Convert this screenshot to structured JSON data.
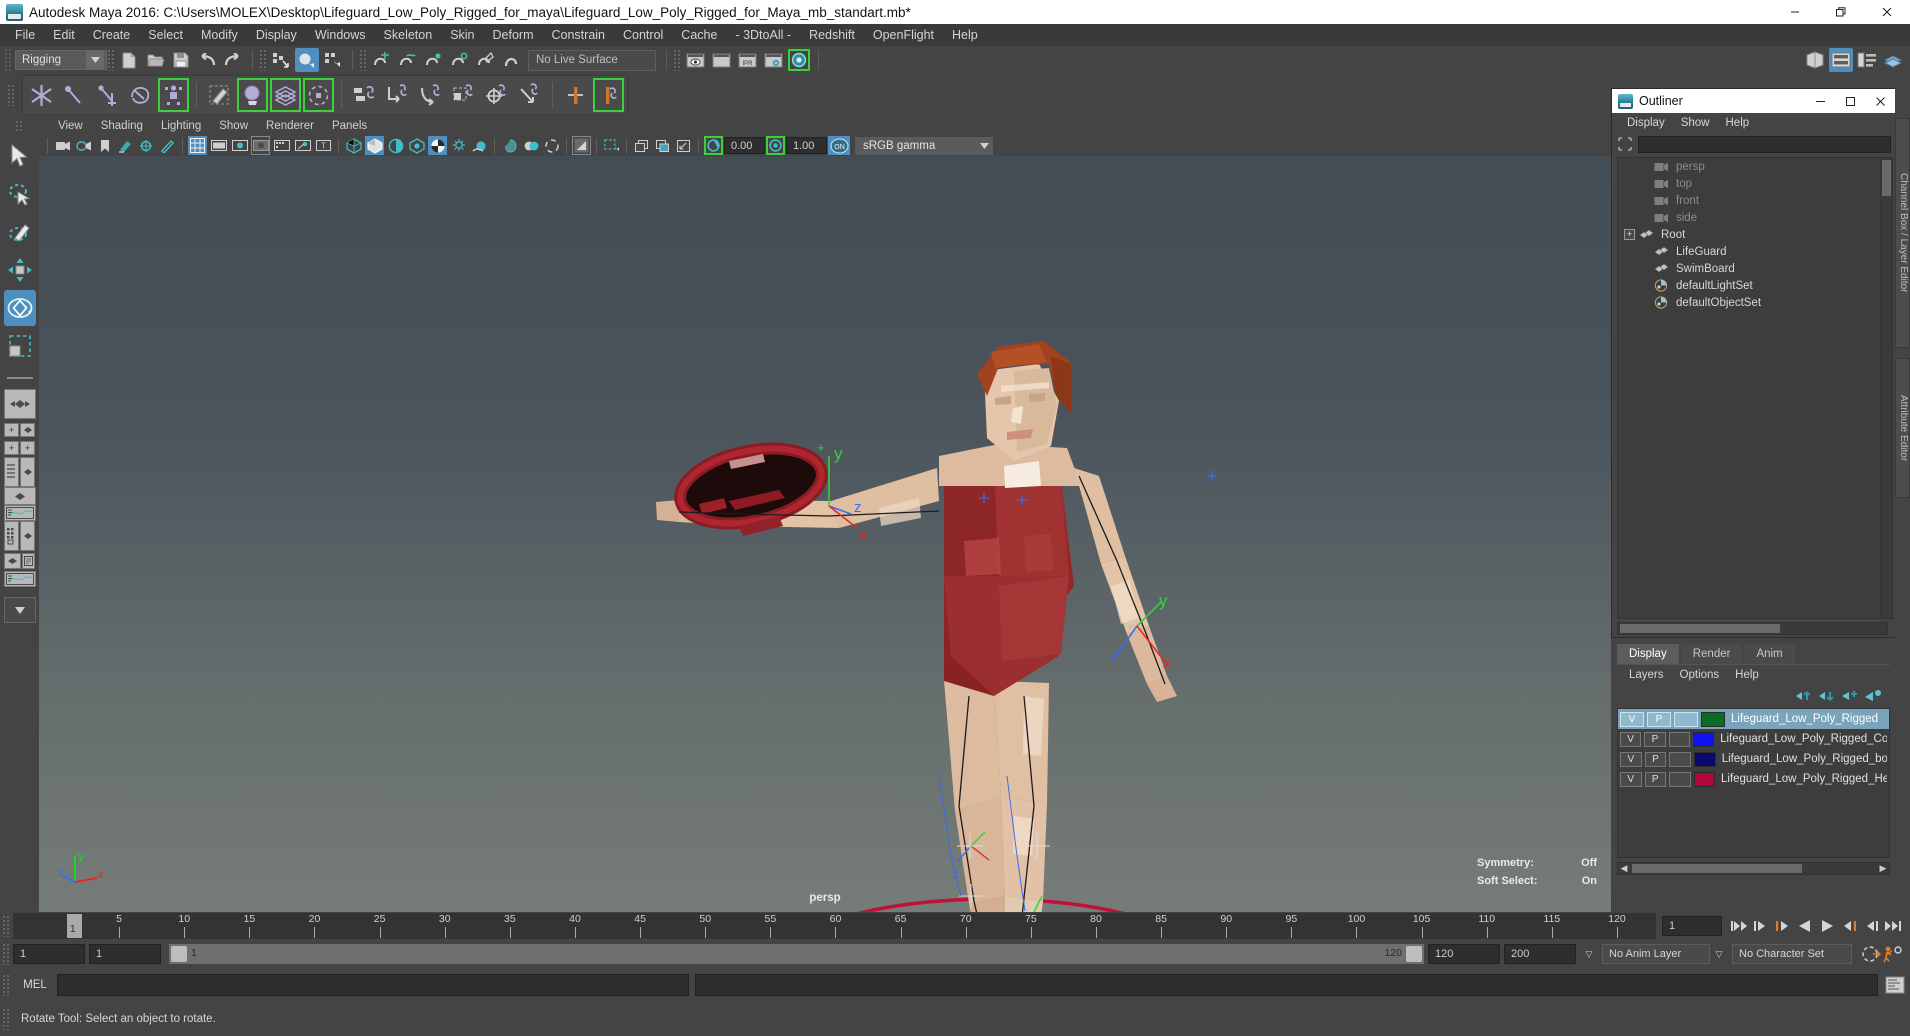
{
  "window": {
    "title": "Autodesk Maya 2016: C:\\Users\\MOLEX\\Desktop\\Lifeguard_Low_Poly_Rigged_for_maya\\Lifeguard_Low_Poly_Rigged_for_Maya_mb_standart.mb*",
    "minimize": "—",
    "maximize": "❐",
    "close": "✕"
  },
  "menubar": {
    "items": [
      {
        "label": "File"
      },
      {
        "label": "Edit"
      },
      {
        "label": "Create"
      },
      {
        "label": "Select"
      },
      {
        "label": "Modify"
      },
      {
        "label": "Display"
      },
      {
        "label": "Windows"
      },
      {
        "label": "Skeleton"
      },
      {
        "label": "Skin"
      },
      {
        "label": "Deform"
      },
      {
        "label": "Constrain"
      },
      {
        "label": "Control"
      },
      {
        "label": "Cache"
      },
      {
        "label": "- 3DtoAll -"
      },
      {
        "label": "Redshift"
      },
      {
        "label": "OpenFlight"
      },
      {
        "label": "Help"
      }
    ]
  },
  "statusline": {
    "menuset": "Rigging",
    "menuset_arrow": "▼",
    "live_surface": "No Live Surface",
    "icons": [
      "new-scene-icon",
      "open-scene-icon",
      "save-scene-icon",
      "undo-icon",
      "redo-icon",
      "select-by-hierarchy-icon",
      "select-by-object-icon",
      "select-by-component-icon",
      "snap-to-grid-icon",
      "snap-to-curve-icon",
      "snap-to-point-icon",
      "snap-to-projected-center-icon",
      "snap-to-view-plane-icon",
      "make-live-icon",
      "render-view-icon",
      "render-sequence-icon",
      "ipr-render-icon",
      "render-settings-icon",
      "hypershade-icon",
      "show-hide-editors-icon",
      "attribute-editor-icon",
      "tool-settings-icon",
      "channel-box-icon"
    ]
  },
  "shelf": {
    "icons": [
      "create-joint-icon",
      "create-ik-handle-icon",
      "create-ik-spline-handle-icon",
      "insert-joint-tool-icon",
      "quick-rig-icon",
      "paint-skin-weights-icon",
      "bind-skin-icon",
      "interactive-bind-icon",
      "smooth-bind-icon",
      "parent-constraint-icon",
      "point-constraint-icon",
      "orient-constraint-icon",
      "scale-constraint-icon",
      "aim-constraint-icon",
      "pole-vector-constraint-icon",
      "mirror-joint-icon",
      "mirror-skin-weights-icon"
    ]
  },
  "toolbox": {
    "tools": [
      {
        "name": "select-tool",
        "active": false
      },
      {
        "name": "lasso-select-tool",
        "active": false
      },
      {
        "name": "paint-select-tool",
        "active": false
      },
      {
        "name": "move-tool",
        "active": false
      },
      {
        "name": "rotate-tool",
        "active": true
      },
      {
        "name": "scale-tool",
        "active": false
      }
    ],
    "layouts": [
      "single-perspective-layout",
      "four-view-layout",
      "outliner-persp-layout",
      "persp-graph-layout",
      "hypershade-persp-layout",
      "persp-graph-outliner-layout",
      "layout-menu"
    ]
  },
  "viewport": {
    "menus": [
      {
        "label": "View"
      },
      {
        "label": "Shading"
      },
      {
        "label": "Lighting"
      },
      {
        "label": "Show"
      },
      {
        "label": "Renderer"
      },
      {
        "label": "Panels"
      }
    ],
    "exposure_value": "0.00",
    "gamma_value": "1.00",
    "color_management": "sRGB gamma",
    "color_management_arrow": "▼",
    "camera_label": "persp",
    "hud": [
      {
        "label": "Symmetry:",
        "value": "Off"
      },
      {
        "label": "Soft Select:",
        "value": "On"
      }
    ],
    "axis": {
      "x": "x",
      "y": "y",
      "z": "z"
    },
    "manipulator_labels": {
      "x": "x",
      "y": "y",
      "z": "z"
    },
    "icons": [
      "select-camera-icon",
      "camera-attributes-icon",
      "bookmark-icon",
      "image-plane-icon",
      "two-d-pan-zoom-icon",
      "grease-pencil-icon",
      "grid-icon",
      "film-gate-icon",
      "resolution-gate-icon",
      "gate-mask-icon",
      "xray-icon",
      "xray-joints-icon",
      "texture-icon",
      "wireframe-icon",
      "smooth-shade-icon",
      "shaded-wireframe-icon",
      "hardware-texturing-icon",
      "use-all-lights-icon",
      "shadows-icon",
      "screen-space-ao-icon",
      "motion-blur-icon",
      "multisample-icon",
      "isolate-select-icon",
      "xray-mode-icon",
      "xray-active-icon",
      "exposure-icon",
      "gamma-icon",
      "color-management-toggle-icon"
    ]
  },
  "outliner": {
    "title": "Outliner",
    "title_icon": "maya-logo-icon",
    "minimize": "—",
    "maximize": "❐",
    "close": "✕",
    "menus": [
      {
        "label": "Display"
      },
      {
        "label": "Show"
      },
      {
        "label": "Help"
      }
    ],
    "search_placeholder": "",
    "search_value": "",
    "search_icon": "filter-icon",
    "items": [
      {
        "label": "persp",
        "icon": "camera-icon",
        "dim": true,
        "expandable": false,
        "indent": 1
      },
      {
        "label": "top",
        "icon": "camera-icon",
        "dim": true,
        "expandable": false,
        "indent": 1
      },
      {
        "label": "front",
        "icon": "camera-icon",
        "dim": true,
        "expandable": false,
        "indent": 1
      },
      {
        "label": "side",
        "icon": "camera-icon",
        "dim": true,
        "expandable": false,
        "indent": 1
      },
      {
        "label": "Root",
        "icon": "transform-icon",
        "dim": false,
        "expandable": true,
        "indent": 0
      },
      {
        "label": "LifeGuard",
        "icon": "transform-icon",
        "dim": false,
        "expandable": false,
        "indent": 1
      },
      {
        "label": "SwimBoard",
        "icon": "transform-icon",
        "dim": false,
        "expandable": false,
        "indent": 1
      },
      {
        "label": "defaultLightSet",
        "icon": "set-icon",
        "dim": false,
        "expandable": false,
        "indent": 1
      },
      {
        "label": "defaultObjectSet",
        "icon": "set-icon",
        "dim": false,
        "expandable": false,
        "indent": 1
      }
    ],
    "expand_glyph": "+"
  },
  "layer_editor": {
    "tabs": [
      {
        "label": "Display",
        "active": true
      },
      {
        "label": "Render",
        "active": false
      },
      {
        "label": "Anim",
        "active": false
      }
    ],
    "menus": [
      {
        "label": "Layers"
      },
      {
        "label": "Options"
      },
      {
        "label": "Help"
      }
    ],
    "toolbar_icons": [
      "move-layer-up-icon",
      "move-layer-down-icon",
      "new-layer-icon",
      "new-layer-from-selected-icon"
    ],
    "columns": [
      "V",
      "P",
      ""
    ],
    "layers": [
      {
        "v": "V",
        "p": "P",
        "third": "",
        "color": "#0a6b22",
        "name": "Lifeguard_Low_Poly_Rigged",
        "selected": true
      },
      {
        "v": "V",
        "p": "P",
        "third": "",
        "color": "#1111ee",
        "name": "Lifeguard_Low_Poly_Rigged_Control",
        "selected": false
      },
      {
        "v": "V",
        "p": "P",
        "third": "",
        "color": "#0a0a6e",
        "name": "Lifeguard_Low_Poly_Rigged_bones",
        "selected": false
      },
      {
        "v": "V",
        "p": "P",
        "third": "",
        "color": "#b0063a",
        "name": "Lifeguard_Low_Poly_Rigged_Helper",
        "selected": false
      }
    ]
  },
  "right_tabs": [
    {
      "label": "Channel Box / Layer Editor"
    },
    {
      "label": "Attribute Editor"
    }
  ],
  "time_slider": {
    "ticks": [
      5,
      10,
      15,
      20,
      25,
      30,
      35,
      40,
      45,
      50,
      55,
      60,
      65,
      70,
      75,
      80,
      85,
      90,
      95,
      100,
      105,
      110,
      115,
      120
    ],
    "start": 1,
    "end": 120,
    "current_frame_marker": "1",
    "current_frame_field": "1",
    "playback_icons": [
      "go-to-start-icon",
      "step-back-frame-icon",
      "step-back-key-icon",
      "play-backwards-icon",
      "play-forwards-icon",
      "step-forward-key-icon",
      "step-forward-frame-icon",
      "go-to-end-icon"
    ]
  },
  "range_slider": {
    "anim_start": "1",
    "range_start": "1",
    "bar_start_label": "1",
    "bar_end_label": "120",
    "range_end": "120",
    "anim_end": "200",
    "anim_layer": "No Anim Layer",
    "character_set": "No Character Set",
    "dropdown_arrow": "▽",
    "icons": [
      "auto-key-icon",
      "animation-preferences-icon"
    ]
  },
  "command_line": {
    "language_label": "MEL",
    "input_value": "",
    "output_value": "",
    "script-editor-icon": "script-editor-icon"
  },
  "help_line": {
    "message": "Rotate Tool: Select an object to rotate."
  }
}
